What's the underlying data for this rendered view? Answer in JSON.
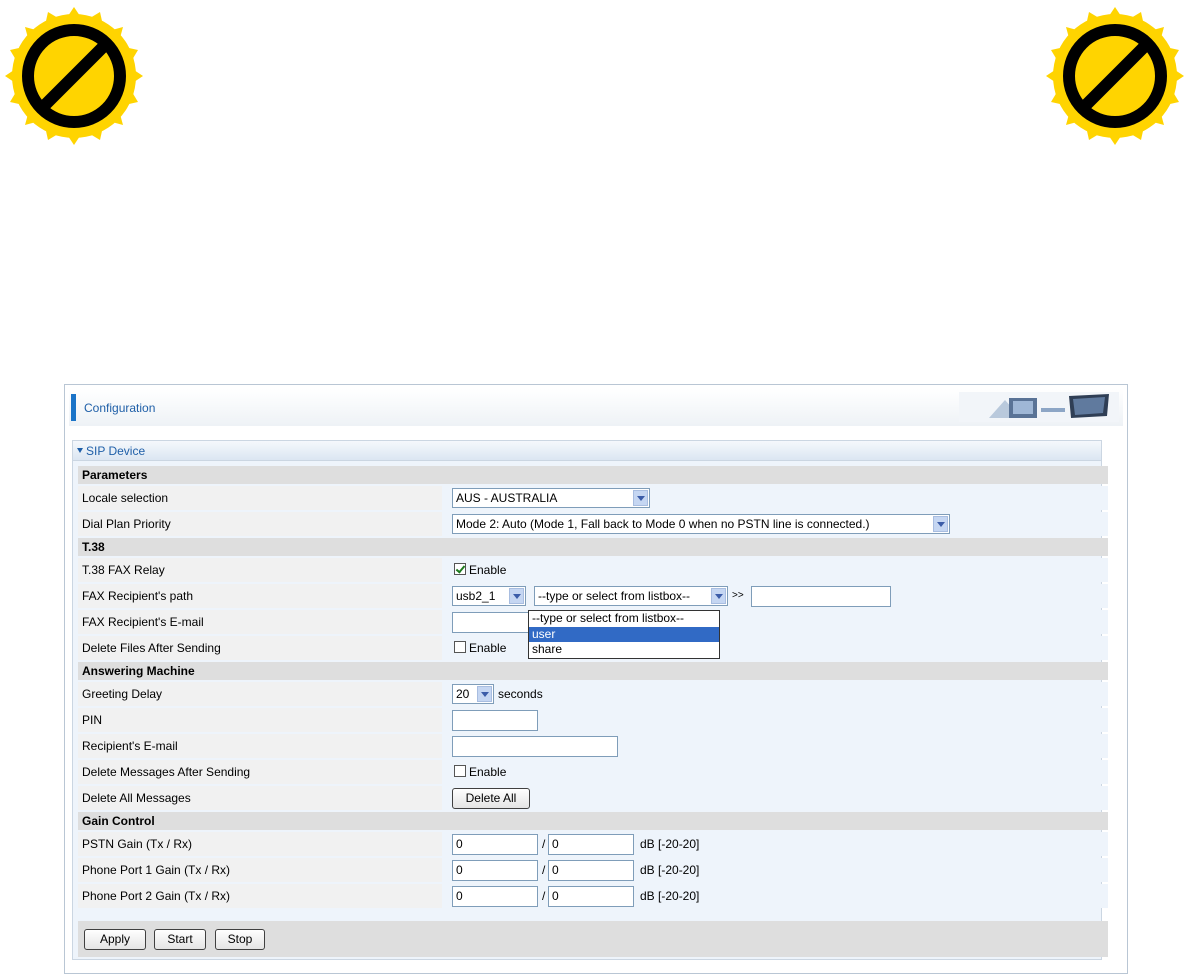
{
  "header": {
    "title": "Configuration"
  },
  "section": {
    "title": "SIP Device"
  },
  "groups": {
    "parameters": "Parameters",
    "t38": "T.38",
    "answering": "Answering Machine",
    "gain": "Gain Control"
  },
  "parameters": {
    "locale_label": "Locale selection",
    "locale_value": "AUS - AUSTRALIA",
    "dialplan_label": "Dial Plan Priority",
    "dialplan_value": "Mode 2: Auto (Mode 1, Fall back to Mode 0 when no PSTN line is connected.)"
  },
  "t38": {
    "fax_relay_label": "T.38 FAX Relay",
    "fax_relay_checked": true,
    "enable_text": "Enable",
    "path_label": "FAX Recipient's path",
    "path_device": "usb2_1",
    "path_folder": "--type or select from listbox--",
    "path_sep": ">>",
    "path_value": "",
    "email_label": "FAX Recipient's E-mail",
    "email_value": "",
    "delete_label": "Delete Files After Sending",
    "delete_checked": false
  },
  "dropdown": {
    "options": [
      "--type or select from listbox--",
      "user",
      "share"
    ],
    "selected": "user"
  },
  "answering": {
    "delay_label": "Greeting Delay",
    "delay_value": "20",
    "delay_unit": "seconds",
    "pin_label": "PIN",
    "pin_value": "",
    "email_label": "Recipient's E-mail",
    "email_value": "",
    "delete_msgs_label": "Delete Messages After Sending",
    "delete_msgs_checked": false,
    "enable_text": "Enable",
    "delete_all_label": "Delete All Messages",
    "delete_all_button": "Delete All"
  },
  "gain": {
    "pstn_label": "PSTN Gain (Tx / Rx)",
    "port1_label": "Phone Port 1 Gain (Tx / Rx)",
    "port2_label": "Phone Port 2 Gain (Tx / Rx)",
    "pstn_tx": "0",
    "pstn_rx": "0",
    "port1_tx": "0",
    "port1_rx": "0",
    "port2_tx": "0",
    "port2_rx": "0",
    "slash": "/",
    "unit": "dB [-20-20]"
  },
  "buttons": {
    "apply": "Apply",
    "start": "Start",
    "stop": "Stop"
  },
  "colors": {
    "accent": "#1b74c8",
    "badge_yellow": "#ffd400",
    "highlight": "#316ac5"
  },
  "icons": {
    "badge": "prohibited-sign-icon"
  }
}
